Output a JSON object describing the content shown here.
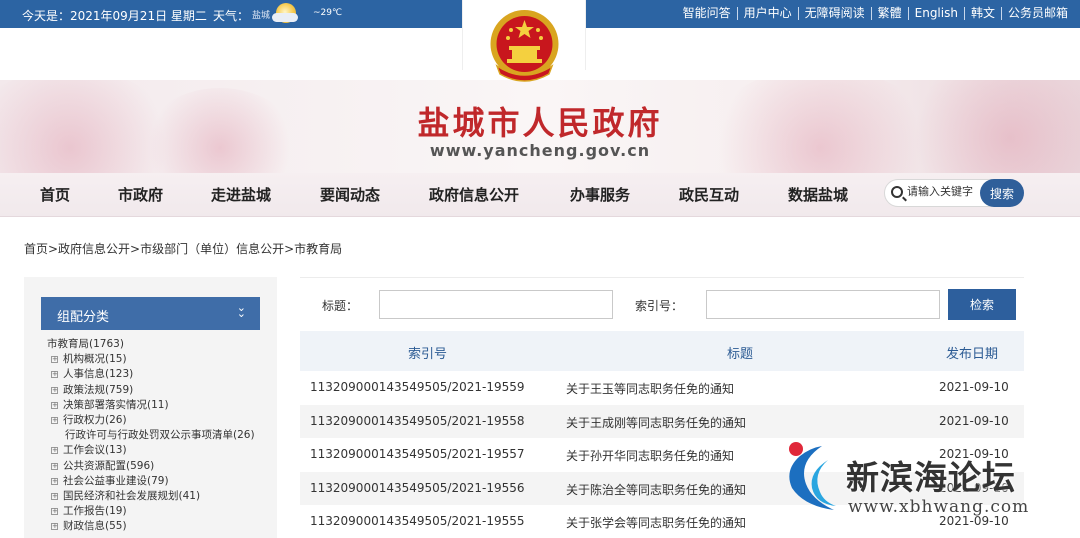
{
  "topbar": {
    "date": "今天是：2021年09月21日 星期二",
    "weather_label": "天气：",
    "weather_city": "盐城",
    "temp": "~29℃",
    "links": [
      "智能问答",
      "用户中心",
      "无障碍阅读",
      "繁體",
      "English",
      "韩文",
      "公务员邮箱"
    ]
  },
  "header": {
    "title": "盐城市人民政府",
    "url": "www.yancheng.gov.cn"
  },
  "nav": {
    "items": [
      "首页",
      "市政府",
      "走进盐城",
      "要闻动态",
      "政府信息公开",
      "办事服务",
      "政民互动",
      "数据盐城"
    ],
    "search_placeholder": "请输入关键字",
    "search_button": "搜索"
  },
  "breadcrumb": "首页>政府信息公开>市级部门（单位）信息公开>市教育局",
  "sidebar": {
    "heading": "组配分类",
    "root": "市教育局(1763)",
    "items": [
      {
        "label": "机构概况(15)",
        "type": "exp"
      },
      {
        "label": "人事信息(123)",
        "type": "exp"
      },
      {
        "label": "政策法规(759)",
        "type": "exp"
      },
      {
        "label": "决策部署落实情况(11)",
        "type": "exp"
      },
      {
        "label": "行政权力(26)",
        "type": "exp"
      },
      {
        "label": "行政许可与行政处罚双公示事项清单(26)",
        "type": "leaf"
      },
      {
        "label": "工作会议(13)",
        "type": "exp"
      },
      {
        "label": "公共资源配置(596)",
        "type": "exp"
      },
      {
        "label": "社会公益事业建设(79)",
        "type": "exp"
      },
      {
        "label": "国民经济和社会发展规划(41)",
        "type": "exp"
      },
      {
        "label": "工作报告(19)",
        "type": "exp"
      },
      {
        "label": "财政信息(55)",
        "type": "exp"
      }
    ]
  },
  "filters": {
    "title_label": "标题：",
    "index_label": "索引号：",
    "search_button": "检索"
  },
  "table": {
    "headers": [
      "索引号",
      "标题",
      "发布日期"
    ],
    "rows": [
      {
        "index": "11320900014354950 5/2021-19559",
        "title": "关于王玉等同志职务任免的通知",
        "date": "2021-09-10"
      },
      {
        "index": "113209000143549505/2021-19558",
        "title": "关于王成刚等同志职务任免的通知",
        "date": "2021-09-10"
      },
      {
        "index": "113209000143549505/2021-19557",
        "title": "关于孙开华同志职务任免的通知",
        "date": "2021-09-10"
      },
      {
        "index": "113209000143549505/2021-19556",
        "title": "关于陈治全等同志职务任免的通知",
        "date": "2021-09-10"
      },
      {
        "index": "113209000143549505/2021-19555",
        "title": "关于张学会等同志职务任免的通知",
        "date": "2021-09-10"
      }
    ]
  },
  "watermark": {
    "title": "新滨海论坛",
    "url": "www.xbhwang.com"
  }
}
